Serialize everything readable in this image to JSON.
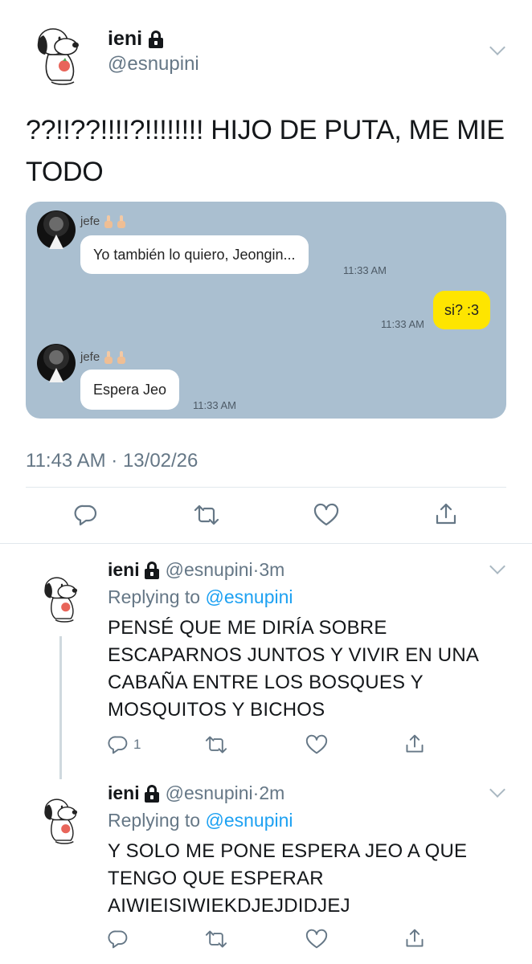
{
  "main_tweet": {
    "author_name": "ieni",
    "author_handle": "@esnupini",
    "text": "??!!??!!!!?!!!!!!!! HIJO DE PUTA, ME MIE TODO",
    "timestamp": "11:43 AM · 13/02/26",
    "embedded_chat": {
      "messages": [
        {
          "sender": "jefe",
          "text": "Yo también lo quiero, Jeongin...",
          "time": "11:33 AM"
        },
        {
          "sender": "me",
          "text": "si? :3",
          "time": "11:33 AM"
        },
        {
          "sender": "jefe",
          "text": "Espera Jeo",
          "time": "11:33 AM"
        }
      ]
    }
  },
  "replies": [
    {
      "author_name": "ieni",
      "author_handle": "@esnupini",
      "age": "3m",
      "replying_prefix": "Replying to",
      "replying_to": "@esnupini",
      "lines": [
        "PENSÉ QUE ME DIRÍA SOBRE",
        "ESCAPARNOS JUNTOS Y VIVIR EN UNA",
        "CABAÑA ENTRE LOS BOSQUES Y",
        "MOSQUITOS Y BICHOS"
      ],
      "reply_count": "1"
    },
    {
      "author_name": "ieni",
      "author_handle": "@esnupini",
      "age": "2m",
      "replying_prefix": "Replying to",
      "replying_to": "@esnupini",
      "lines": [
        "Y SOLO ME PONE ESPERA JEO A QUE",
        "TENGO QUE ESPERAR",
        "AIWIEISIWIEKDJEJDIDJEJ"
      ],
      "reply_count": ""
    }
  ],
  "colors": {
    "text": "#14171a",
    "secondary": "#657786",
    "link": "#1da1f2",
    "chat_bg": "#aabfd0",
    "my_bubble": "#fee500"
  },
  "icons": [
    "snoopy-avatar",
    "lock-icon",
    "caret-down-icon",
    "reply-icon",
    "retweet-icon",
    "like-icon",
    "share-icon",
    "middle-finger-emoji"
  ]
}
